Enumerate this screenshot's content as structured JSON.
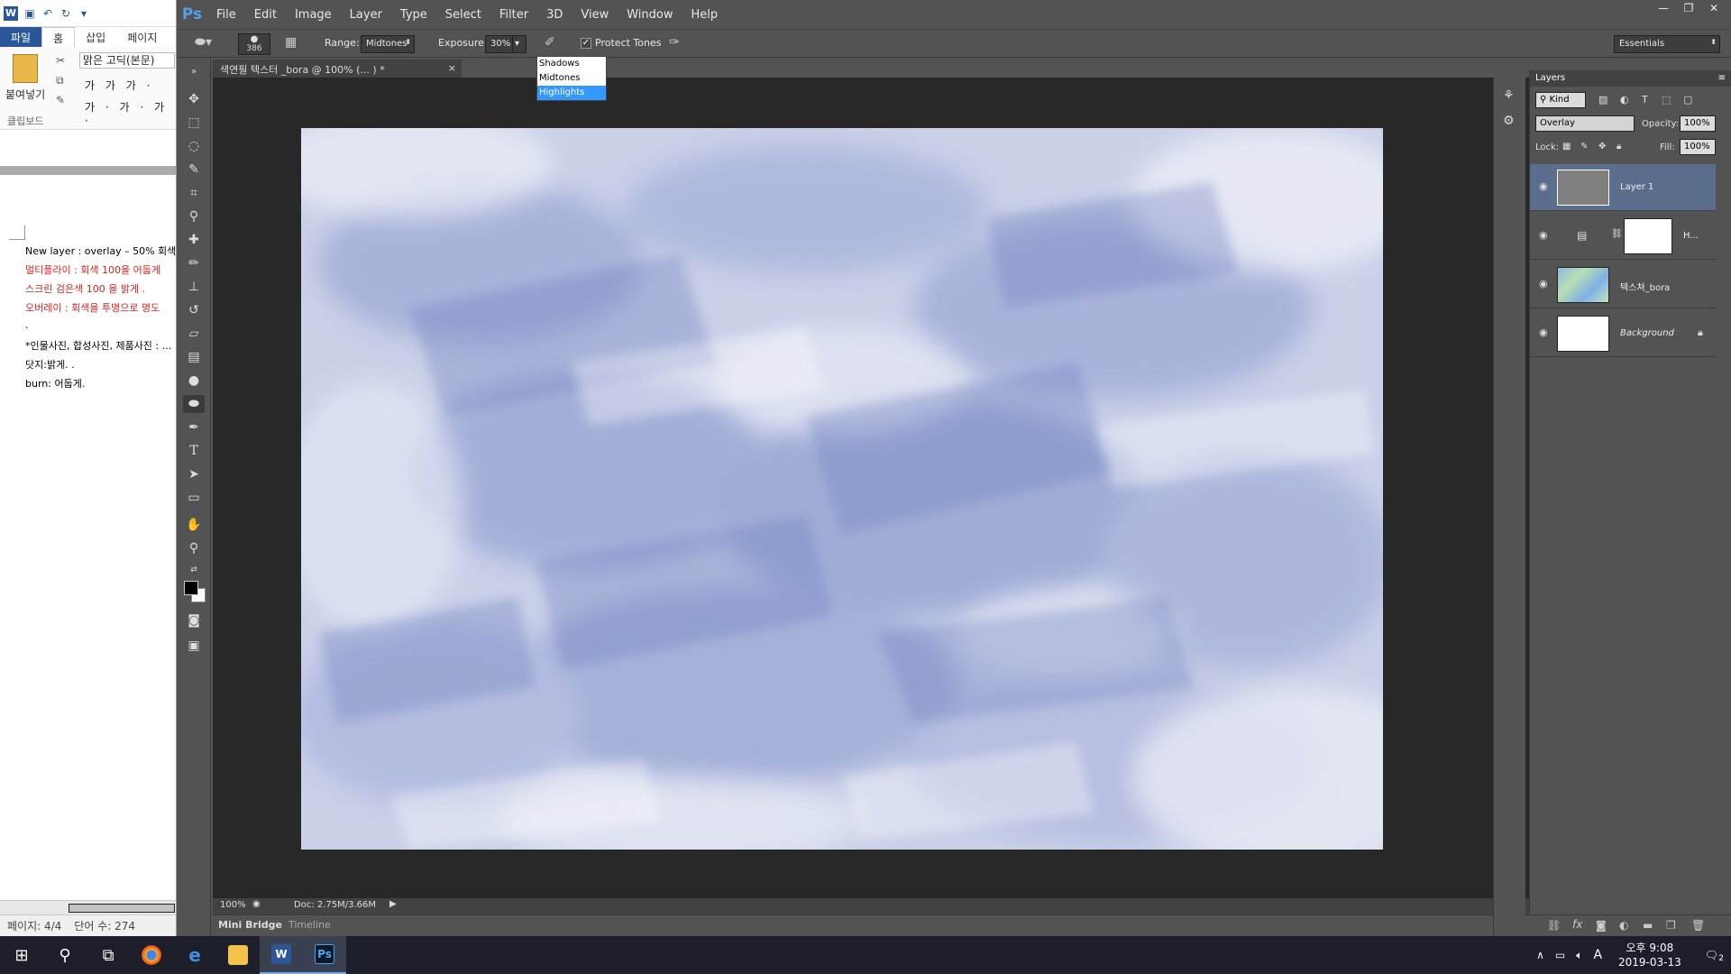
{
  "word": {
    "qat_logo": "W",
    "tabs": [
      "파일",
      "홈",
      "삽입",
      "페이지"
    ],
    "font_name": "맑은 고딕(본문)",
    "format_row1": "가 가 가 ·",
    "format_row2": "가 · 가 · 가 ·",
    "paste_label": "붙여넣기",
    "clipboard_label": "클립보드",
    "doc_lines": [
      {
        "text": "New layer : overlay – 50% 회색 ...",
        "red": false
      },
      {
        "text": "멀티플라이 : 회색 100을 어둡게",
        "red": true
      },
      {
        "text": "스크린 검은색 100 을 밝게 .",
        "red": true
      },
      {
        "text": "오버레이 : 회색을 투명으로 명도",
        "red": true
      },
      {
        "text": ".",
        "red": false
      },
      {
        "text": "*인물사진, 합성사진, 제품사진 : ...",
        "red": false
      },
      {
        "text": "닷지:밝게. .",
        "red": false
      },
      {
        "text": "burn: 어둡게.",
        "red": false
      }
    ],
    "status_page": "페이지: 4/4",
    "status_words": "단어 수: 274"
  },
  "ps": {
    "logo": "Ps",
    "menu": [
      "File",
      "Edit",
      "Image",
      "Layer",
      "Type",
      "Select",
      "Filter",
      "3D",
      "View",
      "Window",
      "Help"
    ],
    "options": {
      "brush_size": "386",
      "range_label": "Range:",
      "range_value": "Midtones",
      "exposure_label": "Exposure:",
      "exposure_value": "30%",
      "protect_tones": "Protect Tones",
      "workspace": "Essentials"
    },
    "range_options": [
      "Shadows",
      "Midtones",
      "Highlights"
    ],
    "doc_tab": "색연필 텍스터 _bora @ 100% (... ) *",
    "status": {
      "zoom": "100%",
      "doc": "Doc: 2.75M/3.66M"
    },
    "bottom_tabs": [
      "Mini Bridge",
      "Timeline"
    ],
    "layers_panel": {
      "title": "Layers",
      "kind": "Kind",
      "blend": "Overlay",
      "opacity_label": "Opacity:",
      "opacity": "100%",
      "lock_label": "Lock:",
      "fill_label": "Fill:",
      "fill": "100%",
      "layers": [
        {
          "name": "Layer 1",
          "selected": true,
          "thumb": "#7f7f7f"
        },
        {
          "name": "H...",
          "selected": false,
          "thumb": "#ffffff"
        },
        {
          "name": "텍스쳐_bora",
          "selected": false,
          "thumb": "texture"
        },
        {
          "name": "Background",
          "selected": false,
          "thumb": "#ffffff"
        }
      ]
    }
  },
  "taskbar": {
    "clock_time": "오후 9:08",
    "clock_date": "2019-03-13",
    "ime": "A",
    "notify_count": "2"
  }
}
